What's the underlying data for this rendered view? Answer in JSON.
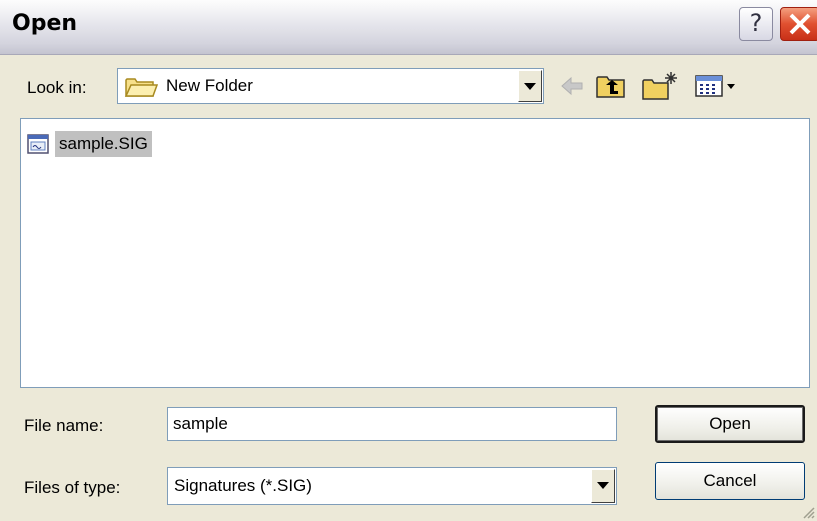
{
  "window": {
    "title": "Open",
    "help_label": "?"
  },
  "look_in": {
    "label": "Look in:",
    "value": "New Folder",
    "icon": "folder-icon"
  },
  "toolbar": {
    "icons": [
      "back-arrow-icon",
      "up-one-level-icon",
      "create-new-folder-icon",
      "view-menu-icon"
    ]
  },
  "file_list": {
    "items": [
      {
        "name": "sample.SIG",
        "icon": "signature-file-icon",
        "selected": true
      }
    ]
  },
  "file_name": {
    "label": "File name:",
    "value": "sample"
  },
  "file_type": {
    "label": "Files of type:",
    "value": "Signatures (*.SIG)"
  },
  "buttons": {
    "open": "Open",
    "cancel": "Cancel"
  },
  "colors": {
    "dialog_bg": "#ece9d8",
    "selection_bg": "#c0c0c0",
    "field_border": "#7f9db9",
    "close_red": "#e05030"
  }
}
